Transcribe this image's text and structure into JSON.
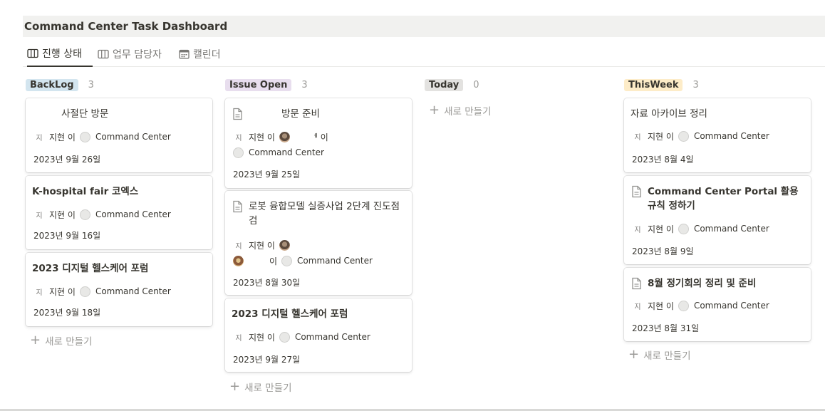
{
  "page": {
    "title": "Command Center Task Dashboard"
  },
  "tabs": [
    {
      "label": "진행 상태",
      "icon": "board-icon",
      "active": true
    },
    {
      "label": "업무 담당자",
      "icon": "board-icon",
      "active": false
    },
    {
      "label": "캘린더",
      "icon": "calendar-icon",
      "active": false
    }
  ],
  "new_label": "새로 만들기",
  "person": "지현 이",
  "avatar_initial": "지",
  "team": "Command Center",
  "columns": [
    {
      "tag": "BackLog",
      "count": "3",
      "color": "#d3e5ef",
      "cards": [
        {
          "title": "사절단 방문",
          "date": "2023년 9월 26일"
        },
        {
          "title": "K-hospital fair 코엑스",
          "date": "2023년 9월 16일"
        },
        {
          "title": "2023 디지털 헬스케어 포럼",
          "date": "2023년 9월 18일"
        }
      ]
    },
    {
      "tag": "Issue Open",
      "count": "3",
      "color": "#e8deee",
      "cards": [
        {
          "title": "방문 준비",
          "date": "2023년 9월 25일",
          "extra_person_1": "ᅦ 이",
          "extra_person_2": ""
        },
        {
          "title": "로봇 융합모델 실증사업 2단계 진도점검",
          "date": "2023년 8월 30일",
          "extra_person_2": "이"
        },
        {
          "title": "2023 디지털 헬스케어 포럼",
          "date": "2023년 9월 27일"
        }
      ]
    },
    {
      "tag": "Today",
      "count": "0",
      "color": "#e3e2e0",
      "cards": []
    },
    {
      "tag": "ThisWeek",
      "count": "3",
      "color": "#fdecc8",
      "cards": [
        {
          "title": "자료 아카이브 정리",
          "date": "2023년 8월 4일"
        },
        {
          "title": "Command Center Portal 활용 규칙 정하기",
          "date": "2023년 8월 9일"
        },
        {
          "title": "8월 정기회의 정리 및 준비",
          "date": "2023년 8월 31일"
        }
      ]
    }
  ]
}
